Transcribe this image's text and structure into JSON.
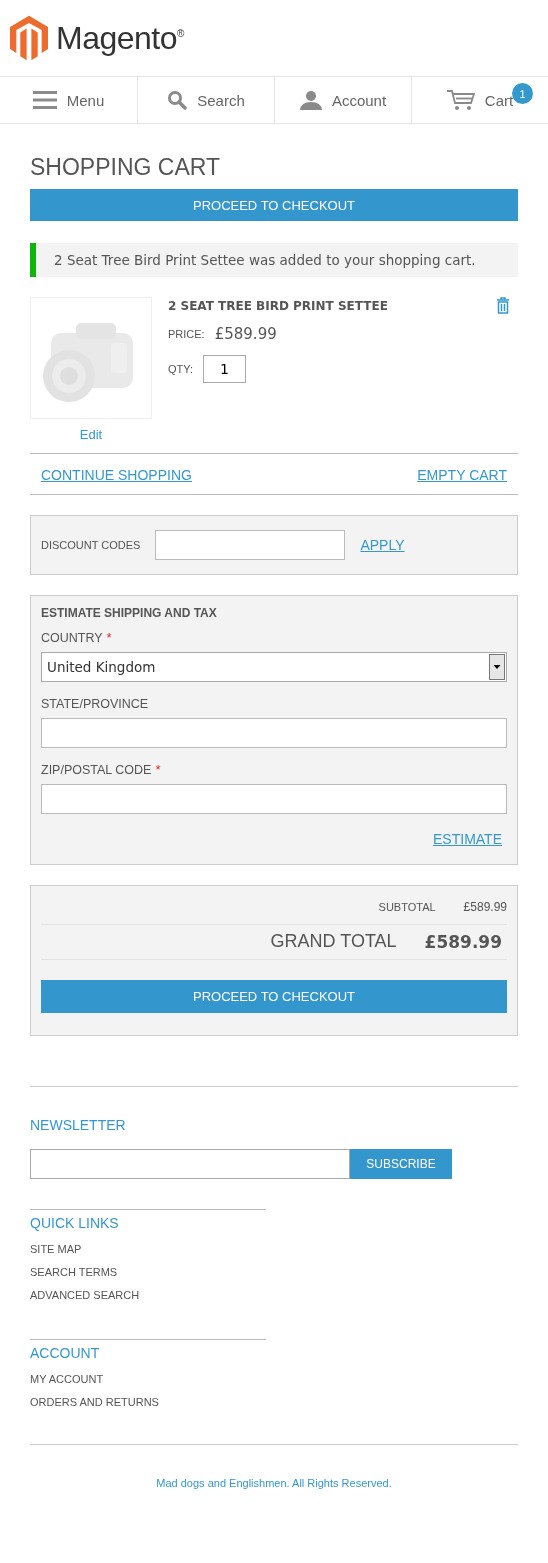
{
  "header": {
    "logo_text": "Magento",
    "logo_mark": "®"
  },
  "nav": [
    {
      "label": "Menu",
      "kind": "menu"
    },
    {
      "label": "Search",
      "kind": "search"
    },
    {
      "label": "Account",
      "kind": "account"
    },
    {
      "label": "Cart",
      "kind": "cart",
      "badge": "1"
    }
  ],
  "page_title": "SHOPPING CART",
  "top_checkout_button": "PROCEED TO CHECKOUT",
  "message": "2 Seat Tree Bird Print Settee was added to your shopping cart.",
  "cart_item": {
    "edit_link": "Edit",
    "name": "2 SEAT TREE BIRD PRINT SETTEE",
    "price_label": "PRICE:",
    "price": "£589.99",
    "qty_label": "QTY:",
    "qty": "1"
  },
  "cart_actions": {
    "continue": "CONTINUE SHOPPING",
    "empty": "EMPTY CART"
  },
  "discount": {
    "label": "DISCOUNT CODES",
    "apply": "APPLY"
  },
  "estimate": {
    "title": "ESTIMATE SHIPPING AND TAX",
    "fields": [
      {
        "kind": "select",
        "label": "COUNTRY",
        "required_mark": "*",
        "value": "United Kingdom"
      },
      {
        "kind": "text",
        "label": "STATE/PROVINCE"
      },
      {
        "kind": "text",
        "label": "ZIP/POSTAL CODE",
        "required_mark": "*"
      }
    ],
    "button": "ESTIMATE"
  },
  "totals": {
    "subtotal_label": "SUBTOTAL",
    "subtotal": "£589.99",
    "grand_label": "GRAND TOTAL",
    "grand": "£589.99",
    "checkout_button": "PROCEED TO CHECKOUT"
  },
  "newsletter": {
    "title": "NEWSLETTER",
    "button": "SUBSCRIBE"
  },
  "footer_sections": [
    {
      "title": "QUICK LINKS",
      "links": [
        "SITE MAP",
        "SEARCH TERMS",
        "ADVANCED SEARCH"
      ]
    },
    {
      "title": "ACCOUNT",
      "links": [
        "MY ACCOUNT",
        "ORDERS AND RETURNS"
      ]
    }
  ],
  "copyright": "Mad dogs and Englishmen. All Rights Reserved."
}
